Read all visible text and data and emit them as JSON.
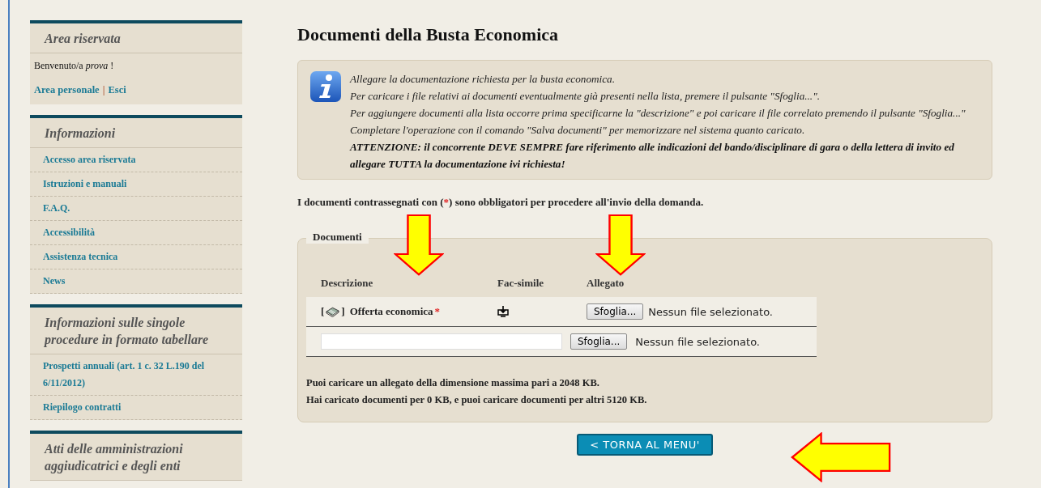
{
  "sidebar": {
    "sections": [
      {
        "kind": "user",
        "title": "Area riservata",
        "welcome": "Benvenuto/a *prova* !",
        "links": [
          {
            "label": "Area personale"
          },
          {
            "label": "Esci"
          }
        ],
        "separator": "|"
      },
      {
        "kind": "menu",
        "title": "Informazioni",
        "items": [
          {
            "label": "Accesso area riservata"
          },
          {
            "label": "Istruzioni e manuali"
          },
          {
            "label": "F.A.Q."
          },
          {
            "label": "Accessibilità"
          },
          {
            "label": "Assistenza tecnica"
          },
          {
            "label": "News"
          }
        ]
      },
      {
        "kind": "menu",
        "title": "Informazioni sulle singole procedure in formato tabellare",
        "items": [
          {
            "label": "Prospetti annuali (art. 1 c. 32 L.190 del 6/11/2012)"
          },
          {
            "label": "Riepilogo contratti"
          }
        ]
      },
      {
        "kind": "menu",
        "title": "Atti delle amministrazioni aggiudicatrici e degli enti"
      }
    ]
  },
  "page_title": "Documenti della Busta Economica",
  "info": {
    "lines": [
      {
        "text": "Allegare la documentazione richiesta per la busta economica.",
        "bold": false
      },
      {
        "text": "Per caricare i file relativi ai documenti eventualmente già presenti nella lista, premere il pulsante \"Sfoglia...\".",
        "bold": false
      },
      {
        "text": "Per aggiungere documenti alla lista occorre prima specificarne la \"descrizione\" e poi caricare il file correlato premendo il pulsante \"Sfoglia...\"",
        "bold": false
      },
      {
        "text": "Completare l'operazione con il comando \"Salva documenti\" per memorizzare nel sistema quanto caricato.",
        "bold": false
      },
      {
        "text": "ATTENZIONE: il concorrente DEVE SEMPRE fare riferimento alle indicazioni del bando/disciplinare di gara o della lettera di invito ed allegare TUTTA la documentazione ivi richiesta!",
        "bold": true
      }
    ]
  },
  "note": {
    "before": "I documenti contrassegnati con (",
    "mark": "*",
    "after": ") sono obbligatori per procedere all'invio della domanda."
  },
  "documents": {
    "legend": "Documenti",
    "columns": [
      "Descrizione",
      "Fac-simile",
      "Allegato"
    ],
    "rows": [
      {
        "kind": "document",
        "open_bracket": "[",
        "close_bracket": "]",
        "name": "Offerta economica",
        "required": true,
        "facsimile": true,
        "button": "Sfoglia...",
        "file_status": "Nessun file selezionato."
      },
      {
        "kind": "new",
        "button": "Sfoglia...",
        "file_status": "Nessun file selezionato."
      }
    ],
    "limits": [
      "Puoi caricare un allegato della dimensione massima pari a 2048 KB.",
      "Hai caricato documenti per 0 KB, e puoi caricare documenti per altri 5120 KB."
    ]
  },
  "back_button": "< TORNA AL MENU'"
}
